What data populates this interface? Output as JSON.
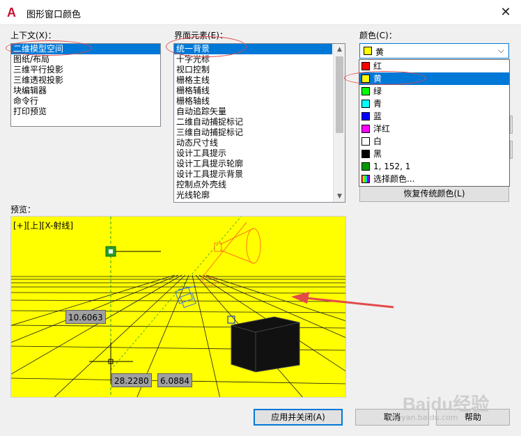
{
  "window": {
    "title": "图形窗口颜色",
    "logo": "A"
  },
  "context": {
    "label": "上下文(X)：",
    "items": [
      "二维模型空间",
      "图纸/布局",
      "三维平行投影",
      "三维透视投影",
      "块编辑器",
      "命令行",
      "打印预览"
    ],
    "selected_index": 0
  },
  "interface": {
    "label": "界面元素(E)：",
    "items": [
      "统一背景",
      "十字光标",
      "视口控制",
      "栅格主线",
      "栅格辅线",
      "栅格轴线",
      "自动追踪矢量",
      "二维自动捕捉标记",
      "三维自动捕捉标记",
      "动态尺寸线",
      "设计工具提示",
      "设计工具提示轮廓",
      "设计工具提示背景",
      "控制点外壳线",
      "光线轮廓"
    ],
    "selected_index": 0
  },
  "color": {
    "label": "颜色(C)：",
    "selected_value": "黄",
    "selected_color": "#ffff00",
    "options": [
      {
        "label": "红",
        "color": "#ff0000"
      },
      {
        "label": "黄",
        "color": "#ffff00"
      },
      {
        "label": "绿",
        "color": "#00ff00"
      },
      {
        "label": "青",
        "color": "#00ffff"
      },
      {
        "label": "蓝",
        "color": "#0000ff"
      },
      {
        "label": "洋红",
        "color": "#ff00ff"
      },
      {
        "label": "白",
        "color": "#ffffff"
      },
      {
        "label": "黑",
        "color": "#000000"
      },
      {
        "label": "1, 152, 1",
        "color": "#019801"
      },
      {
        "label": "选择颜色...",
        "color": "rainbow"
      }
    ],
    "highlighted_index": 1
  },
  "restore_button": "恢复传统颜色(L)",
  "preview": {
    "label": "预览：",
    "viewport_label": "[+][上][X-射线]",
    "background": "#ffff00",
    "dims": [
      "10.6063",
      "28.2280",
      "6.0884"
    ]
  },
  "buttons": {
    "apply_close": "应用并关闭(A)",
    "cancel": "取消",
    "help": "帮助"
  },
  "watermark": {
    "main": "Baidu经验",
    "sub": "jingyan.baidu.com"
  }
}
